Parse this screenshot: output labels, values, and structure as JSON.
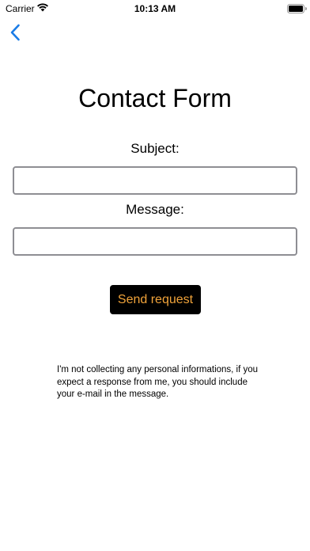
{
  "status_bar": {
    "carrier": "Carrier",
    "time": "10:13 AM"
  },
  "nav": {
    "back_icon": "chevron-left-icon"
  },
  "form": {
    "title": "Contact Form",
    "subject_label": "Subject:",
    "subject_value": "",
    "message_label": "Message:",
    "message_value": "",
    "send_label": "Send request"
  },
  "disclaimer": "I'm not collecting any personal informations, if you expect a response from me, you should include your e-mail in the message.",
  "colors": {
    "accent": "#1a7ce6",
    "button_background": "#000000",
    "button_text": "#f0a33a",
    "field_border": "#8e8e93"
  }
}
